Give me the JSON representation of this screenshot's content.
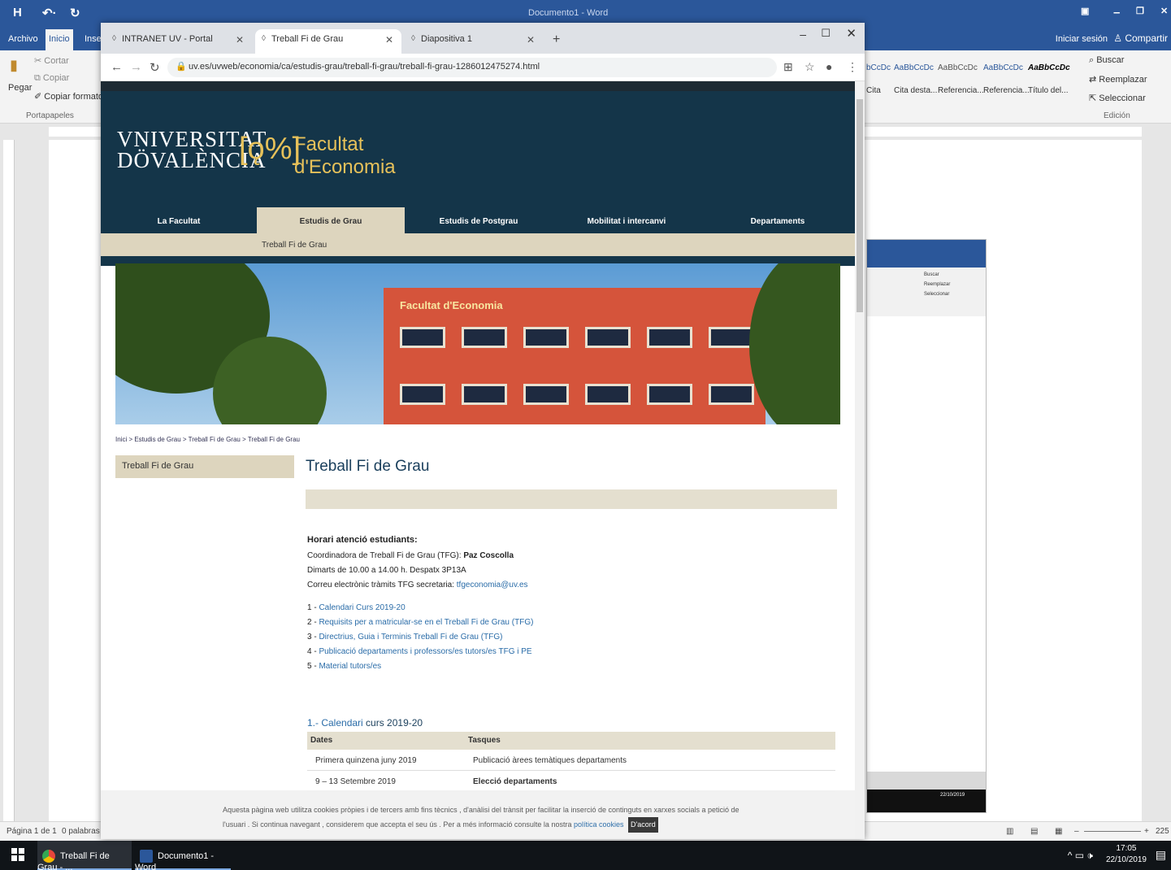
{
  "word": {
    "title": "Documento1 - Word",
    "tabs": [
      "Archivo",
      "Inicio",
      "Inser"
    ],
    "signin": "Iniciar sesión",
    "share": "Compartir",
    "clipboard": {
      "cut": "Cortar",
      "copy": "Copiar",
      "paste": "Pegar",
      "format_painter": "Copiar formato",
      "group": "Portapapeles"
    },
    "styles": [
      {
        "sample": "bCcDc",
        "label": "Cita"
      },
      {
        "sample": "AaBbCcDc",
        "label": "Cita desta..."
      },
      {
        "sample": "AaBbCcDc",
        "label": "Referencia..."
      },
      {
        "sample": "AaBbCcDc",
        "label": "Referencia..."
      },
      {
        "sample": "AaBbCcDc",
        "label": "Título del..."
      }
    ],
    "editing": {
      "find": "Buscar",
      "replace": "Reemplazar",
      "select": "Seleccionar",
      "group": "Edición"
    },
    "status": {
      "page": "Página 1 de 1",
      "words": "0 palabras",
      "zoom": "225"
    }
  },
  "taskbar": {
    "items": [
      {
        "label": "Treball Fi de Grau - ...",
        "color": "#e8453c"
      },
      {
        "label": "Documento1 - Word",
        "color": "#2b579a"
      }
    ],
    "time": "17:05",
    "date": "22/10/2019"
  },
  "chrome": {
    "tabs": [
      {
        "label": "INTRANET UV - Portal"
      },
      {
        "label": "Treball Fi de Grau"
      },
      {
        "label": "Diapositiva 1"
      }
    ],
    "url": "uv.es/uvweb/economia/ca/estudis-grau/treball-fi-grau/treball-fi-grau-1286012475274.html"
  },
  "site": {
    "logo_univ_line1": "VNIVERSITAT",
    "logo_univ_line2": "DӦVALÈNCIA",
    "logo_fac_line1": "Facultat",
    "logo_fac_line2": "d'Economia",
    "nav": [
      "La Facultat",
      "Estudis de Grau",
      "Estudis de Postgrau",
      "Mobilitat i intercanvi",
      "Departaments"
    ],
    "subnav": "Treball Fi de Grau",
    "hero_sign": "Facultat d'Economia",
    "breadcrumb": "Inici > Estudis de Grau > Treball Fi de Grau > Treball Fi de Grau",
    "left_menu": "Treball Fi de Grau",
    "page_title": "Treball Fi de Grau",
    "horari_title": "Horari atenció estudiants:",
    "coord_prefix": "Coordinadora de Treball Fi de Grau (TFG):",
    "coord_name": "Paz Coscolla",
    "hours": "Dimarts de 10.00 a 14.00 h. Despatx 3P13A",
    "email_prefix": "Correu electrònic tràmits TFG secretaria:",
    "email": "tfgeconomia@uv.es",
    "links": [
      {
        "num": "1 -",
        "text": "Calendari Curs 2019-20"
      },
      {
        "num": "2 -",
        "text": "Requisits per a matricular-se en el Treball Fi de Grau (TFG)"
      },
      {
        "num": "3 -",
        "text": "Directrius, Guia i Terminis Treball Fi de Grau (TFG)"
      },
      {
        "num": "4 -",
        "text": "Publicació departaments i professors/es tutors/es TFG i PE"
      },
      {
        "num": "5 -",
        "text": "Material tutors/es"
      }
    ],
    "calendar_title_link": "1.- Calendari",
    "calendar_title_rest": "curs 2019-20",
    "table_headers": [
      "Dates",
      "Tasques"
    ],
    "table_rows": [
      {
        "date": "Primera quinzena juny 2019",
        "task": "Publicació àrees temàtiques departaments"
      },
      {
        "date": "9 – 13 Setembre 2019",
        "task": "Elecció departaments"
      }
    ],
    "cookie_text": "Aquesta pàgina web utilitza cookies pròpies i de tercers amb fins tècnics , d'anàlisi del trànsit per facilitar la inserció de continguts en xarxes socials a petició de l'usuari . Si continua navegant , considerem que accepta el seu ús . Per a més informació consulte la nostra",
    "cookie_link": "política cookies",
    "cookie_button": "D'acord"
  }
}
